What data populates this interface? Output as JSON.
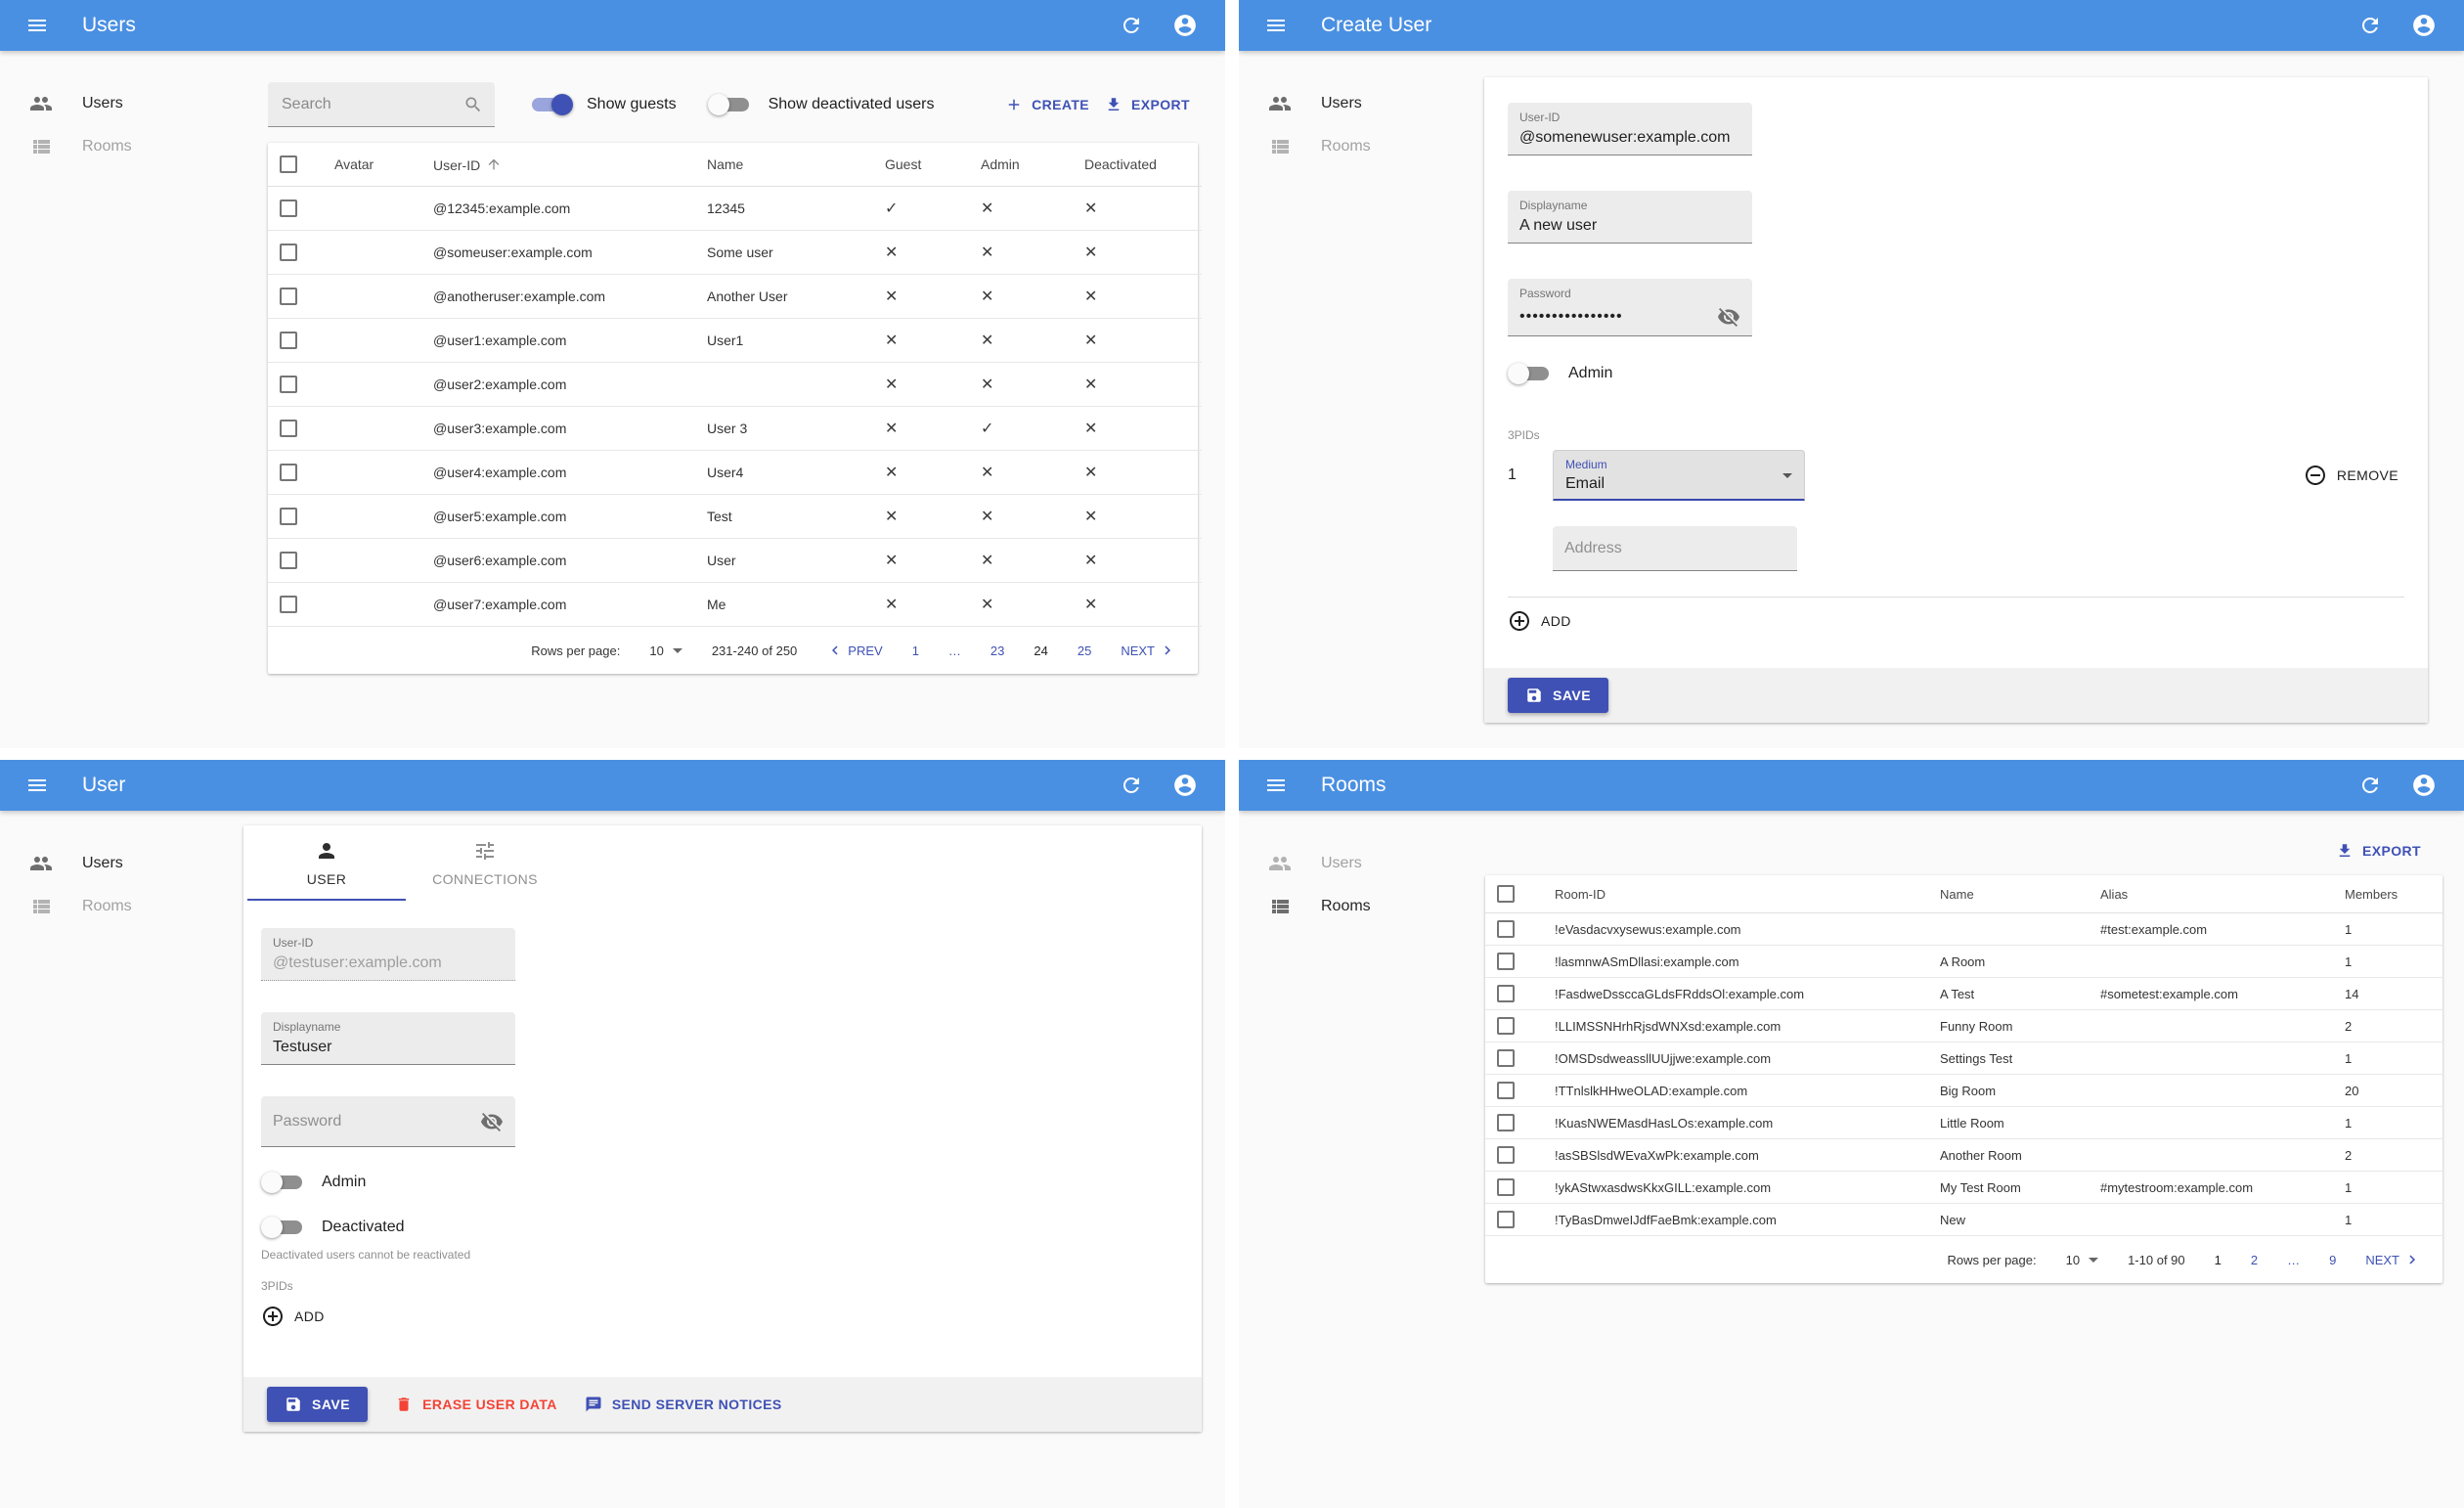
{
  "colors": {
    "appbar": "#4a90e2",
    "accent": "#3f51b5",
    "danger": "#f44336"
  },
  "icons": {
    "menu": "hamburger",
    "refresh": "circular-arrow",
    "account": "person-in-circle",
    "users_nav": "two-people",
    "rooms_nav": "list-grid",
    "search": "magnifier",
    "sort": "arrow-up",
    "create": "plus",
    "export": "download-arrow",
    "visibility": "eye-slash",
    "select_caret": "triangle-down",
    "remove": "circled-minus",
    "add": "circled-plus",
    "save": "floppy-disk",
    "erase": "trash-can",
    "notices": "speech-bubble-lines",
    "prev": "chevron-left",
    "next": "chevron-right",
    "user_tab": "person-silhouette",
    "connections_tab": "tune-sliders",
    "checkbox": "empty-square",
    "yes": "check-mark",
    "no": "cross-mark"
  },
  "users_list": {
    "title": "Users",
    "nav": {
      "users": "Users",
      "rooms": "Rooms"
    },
    "search_placeholder": "Search",
    "show_guests_label": "Show guests",
    "show_deactivated_label": "Show deactivated users",
    "create_label": "CREATE",
    "export_label": "EXPORT",
    "columns": {
      "avatar": "Avatar",
      "user_id": "User-ID",
      "name": "Name",
      "guest": "Guest",
      "admin": "Admin",
      "deactivated": "Deactivated"
    },
    "rows": [
      {
        "user_id": "@12345:example.com",
        "name": "12345",
        "guest": "✓",
        "admin": "✕",
        "deactivated": "✕"
      },
      {
        "user_id": "@someuser:example.com",
        "name": "Some user",
        "guest": "✕",
        "admin": "✕",
        "deactivated": "✕"
      },
      {
        "user_id": "@anotheruser:example.com",
        "name": "Another User",
        "guest": "✕",
        "admin": "✕",
        "deactivated": "✕"
      },
      {
        "user_id": "@user1:example.com",
        "name": "User1",
        "guest": "✕",
        "admin": "✕",
        "deactivated": "✕"
      },
      {
        "user_id": "@user2:example.com",
        "name": "",
        "guest": "✕",
        "admin": "✕",
        "deactivated": "✕"
      },
      {
        "user_id": "@user3:example.com",
        "name": "User 3",
        "guest": "✕",
        "admin": "✓",
        "deactivated": "✕"
      },
      {
        "user_id": "@user4:example.com",
        "name": "User4",
        "guest": "✕",
        "admin": "✕",
        "deactivated": "✕"
      },
      {
        "user_id": "@user5:example.com",
        "name": "Test",
        "guest": "✕",
        "admin": "✕",
        "deactivated": "✕"
      },
      {
        "user_id": "@user6:example.com",
        "name": "User",
        "guest": "✕",
        "admin": "✕",
        "deactivated": "✕"
      },
      {
        "user_id": "@user7:example.com",
        "name": "Me",
        "guest": "✕",
        "admin": "✕",
        "deactivated": "✕"
      }
    ],
    "pagination": {
      "rows_per_page_label": "Rows per page:",
      "rows_per_page": "10",
      "range": "231-240 of 250",
      "prev": "PREV",
      "next": "NEXT",
      "page_1": "1",
      "ellipsis": "…",
      "page_23": "23",
      "page_24": "24",
      "page_25": "25",
      "current_page": "24"
    }
  },
  "create_user": {
    "title": "Create User",
    "nav": {
      "users": "Users",
      "rooms": "Rooms"
    },
    "user_id": {
      "label": "User-ID",
      "value": "@somenewuser:example.com"
    },
    "displayname": {
      "label": "Displayname",
      "value": "A new user"
    },
    "password": {
      "label": "Password",
      "value": "••••••••••••••••"
    },
    "admin_label": "Admin",
    "threepids_label": "3PIDs",
    "item_index": "1",
    "medium": {
      "label": "Medium",
      "value": "Email"
    },
    "remove_label": "REMOVE",
    "address_placeholder": "Address",
    "add_label": "ADD",
    "save_label": "SAVE"
  },
  "user_edit": {
    "title": "User",
    "nav": {
      "users": "Users",
      "rooms": "Rooms"
    },
    "tabs": {
      "user": "USER",
      "connections": "CONNECTIONS"
    },
    "user_id": {
      "label": "User-ID",
      "value": "@testuser:example.com"
    },
    "displayname": {
      "label": "Displayname",
      "value": "Testuser"
    },
    "password_placeholder": "Password",
    "admin_label": "Admin",
    "deactivated_label": "Deactivated",
    "deactivated_helper": "Deactivated users cannot be reactivated",
    "threepids_label": "3PIDs",
    "add_label": "ADD",
    "save_label": "SAVE",
    "erase_label": "ERASE USER DATA",
    "notices_label": "SEND SERVER NOTICES"
  },
  "rooms_list": {
    "title": "Rooms",
    "nav": {
      "users": "Users",
      "rooms": "Rooms"
    },
    "export_label": "EXPORT",
    "columns": {
      "room_id": "Room-ID",
      "name": "Name",
      "alias": "Alias",
      "members": "Members"
    },
    "rows": [
      {
        "room_id": "!eVasdacvxysewus:example.com",
        "name": "",
        "alias": "#test:example.com",
        "members": "1"
      },
      {
        "room_id": "!lasmnwASmDllasi:example.com",
        "name": "A Room",
        "alias": "",
        "members": "1"
      },
      {
        "room_id": "!FasdweDssccaGLdsFRddsOl:example.com",
        "name": "A Test",
        "alias": "#sometest:example.com",
        "members": "14"
      },
      {
        "room_id": "!LLIMSSNHrhRjsdWNXsd:example.com",
        "name": "Funny Room",
        "alias": "",
        "members": "2"
      },
      {
        "room_id": "!OMSDsdweassllUUjjwe:example.com",
        "name": "Settings Test",
        "alias": "",
        "members": "1"
      },
      {
        "room_id": "!TTnlslkHHweOLAD:example.com",
        "name": "Big Room",
        "alias": "",
        "members": "20"
      },
      {
        "room_id": "!KuasNWEMasdHasLOs:example.com",
        "name": "Little Room",
        "alias": "",
        "members": "1"
      },
      {
        "room_id": "!asSBSlsdWEvaXwPk:example.com",
        "name": "Another Room",
        "alias": "",
        "members": "2"
      },
      {
        "room_id": "!ykAStwxasdwsKkxGILL:example.com",
        "name": "My Test Room",
        "alias": "#mytestroom:example.com",
        "members": "1"
      },
      {
        "room_id": "!TyBasDmweIJdfFaeBmk:example.com",
        "name": "New",
        "alias": "",
        "members": "1"
      }
    ],
    "pagination": {
      "rows_per_page_label": "Rows per page:",
      "rows_per_page": "10",
      "range": "1-10 of 90",
      "next": "NEXT",
      "page_1": "1",
      "page_2": "2",
      "ellipsis": "…",
      "page_9": "9",
      "current_page": "1"
    }
  }
}
